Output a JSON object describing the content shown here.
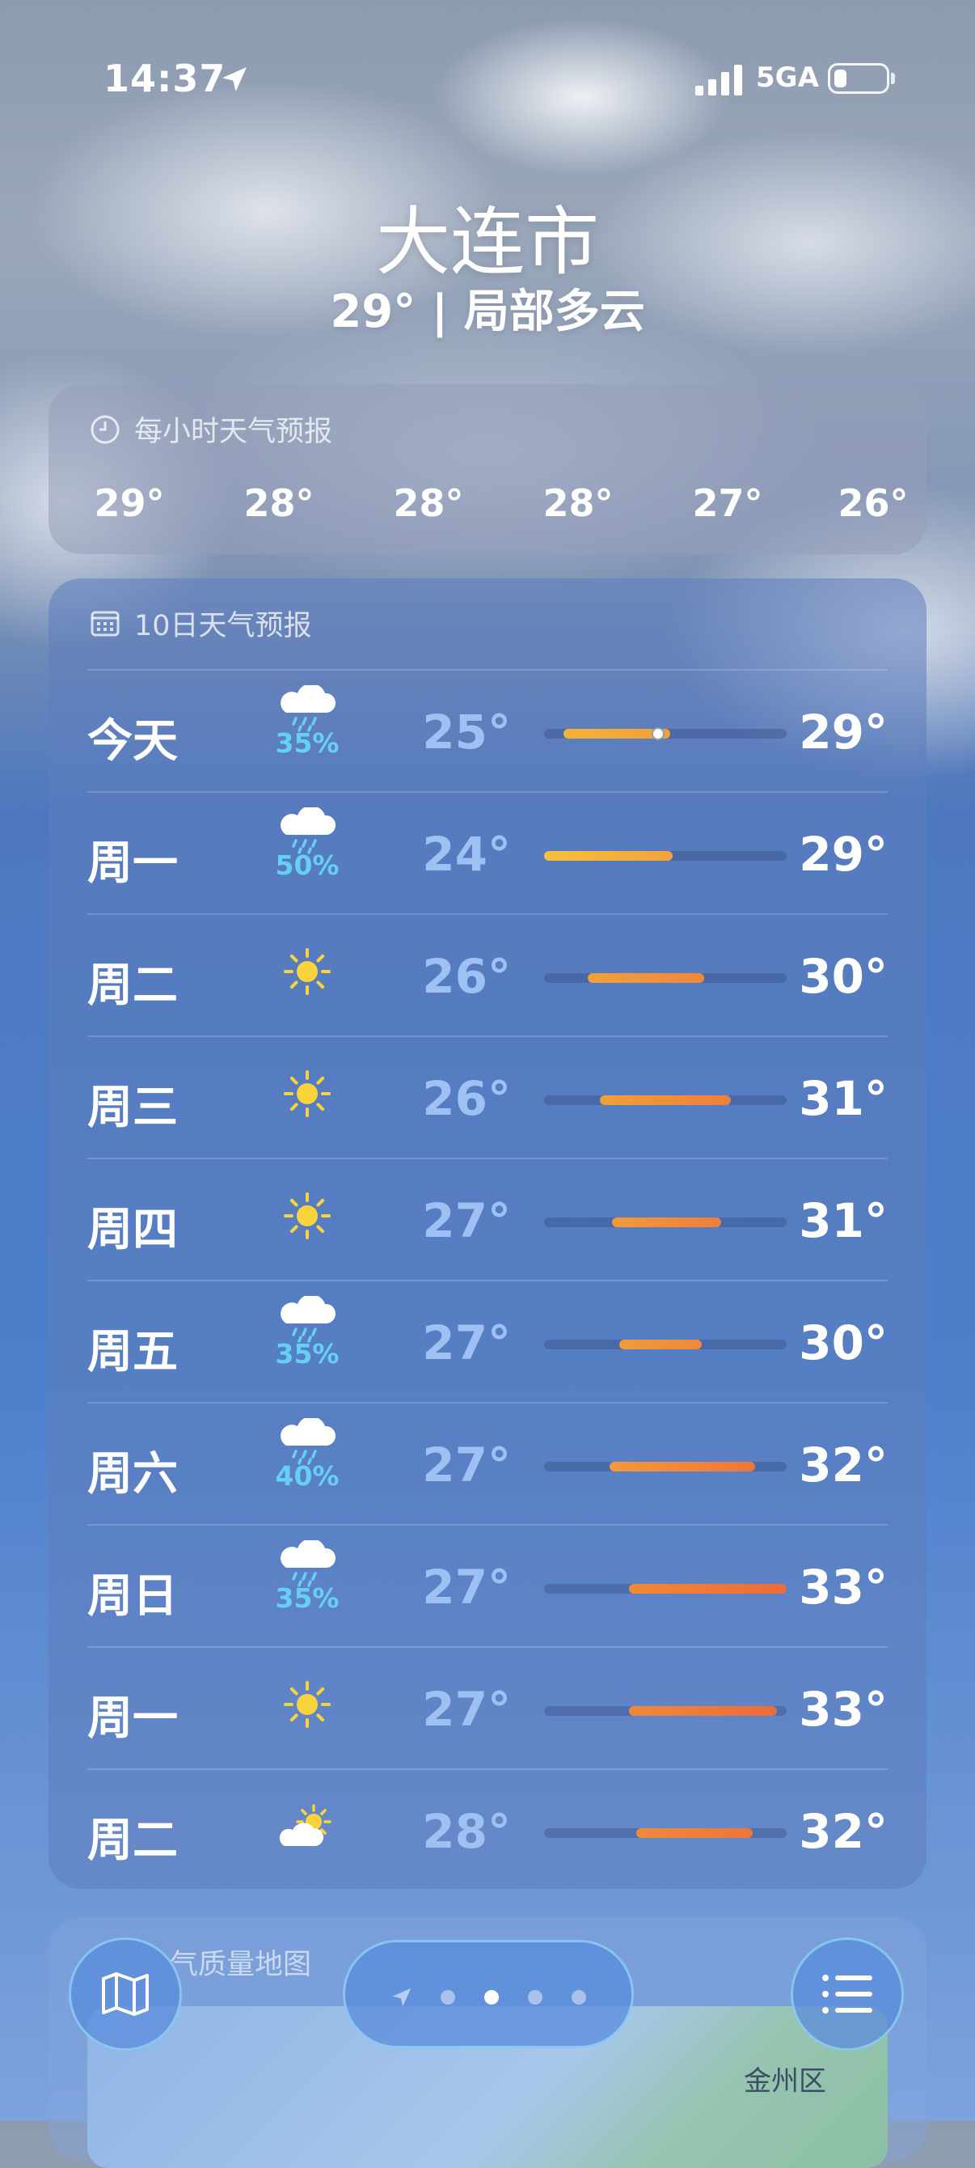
{
  "status_bar": {
    "time": "14:37",
    "network": "5GA",
    "location_icon": "location-arrow-icon",
    "battery_level": 0.2
  },
  "location": {
    "city": "大连市",
    "current": "29° | 局部多云"
  },
  "hourly": {
    "title": "每小时天气预报",
    "icon": "clock-icon",
    "temps": [
      "29°",
      "28°",
      "28°",
      "28°",
      "27°",
      "26°"
    ]
  },
  "daily": {
    "title": "10日天气预报",
    "icon": "calendar-icon",
    "days": [
      {
        "day": "今天",
        "icon": "cloud-rain-icon",
        "precip": "35%",
        "low": "25°",
        "high": "29°",
        "bar_start": 0.08,
        "bar_end": 0.52,
        "now": 0.47,
        "color1": "#f3b23a",
        "color2": "#f2a03a"
      },
      {
        "day": "周一",
        "icon": "cloud-rain-icon",
        "precip": "50%",
        "low": "24°",
        "high": "29°",
        "bar_start": 0.0,
        "bar_end": 0.53,
        "color1": "#f5c03e",
        "color2": "#f2a43a"
      },
      {
        "day": "周二",
        "icon": "sun-icon",
        "precip": "",
        "low": "26°",
        "high": "30°",
        "bar_start": 0.18,
        "bar_end": 0.66,
        "color1": "#f2a03a",
        "color2": "#f0883a"
      },
      {
        "day": "周三",
        "icon": "sun-icon",
        "precip": "",
        "low": "26°",
        "high": "31°",
        "bar_start": 0.23,
        "bar_end": 0.77,
        "color1": "#f2a03a",
        "color2": "#ef7f3a"
      },
      {
        "day": "周四",
        "icon": "sun-icon",
        "precip": "",
        "low": "27°",
        "high": "31°",
        "bar_start": 0.28,
        "bar_end": 0.73,
        "color1": "#f19a3a",
        "color2": "#ef7f3a"
      },
      {
        "day": "周五",
        "icon": "cloud-rain-icon",
        "precip": "35%",
        "low": "27°",
        "high": "30°",
        "bar_start": 0.31,
        "bar_end": 0.65,
        "color1": "#f19a3a",
        "color2": "#f0883a"
      },
      {
        "day": "周六",
        "icon": "cloud-rain-icon",
        "precip": "40%",
        "low": "27°",
        "high": "32°",
        "bar_start": 0.27,
        "bar_end": 0.87,
        "color1": "#f19a3a",
        "color2": "#ee763a"
      },
      {
        "day": "周日",
        "icon": "cloud-rain-icon",
        "precip": "35%",
        "low": "27°",
        "high": "33°",
        "bar_start": 0.35,
        "bar_end": 1.0,
        "color1": "#f08a3a",
        "color2": "#ec6a3a"
      },
      {
        "day": "周一",
        "icon": "sun-icon",
        "precip": "",
        "low": "27°",
        "high": "33°",
        "bar_start": 0.35,
        "bar_end": 0.96,
        "color1": "#f08a3a",
        "color2": "#ec6a3a"
      },
      {
        "day": "周二",
        "icon": "partly-cloudy-icon",
        "precip": "",
        "low": "28°",
        "high": "32°",
        "bar_start": 0.38,
        "bar_end": 0.86,
        "color1": "#f08a3a",
        "color2": "#ee763a"
      }
    ]
  },
  "air_quality": {
    "title": "气质量地图",
    "place": "金州区"
  },
  "bottom_bar": {
    "map_icon": "map-icon",
    "list_icon": "list-icon",
    "page_count": 4,
    "active_page": 2
  }
}
